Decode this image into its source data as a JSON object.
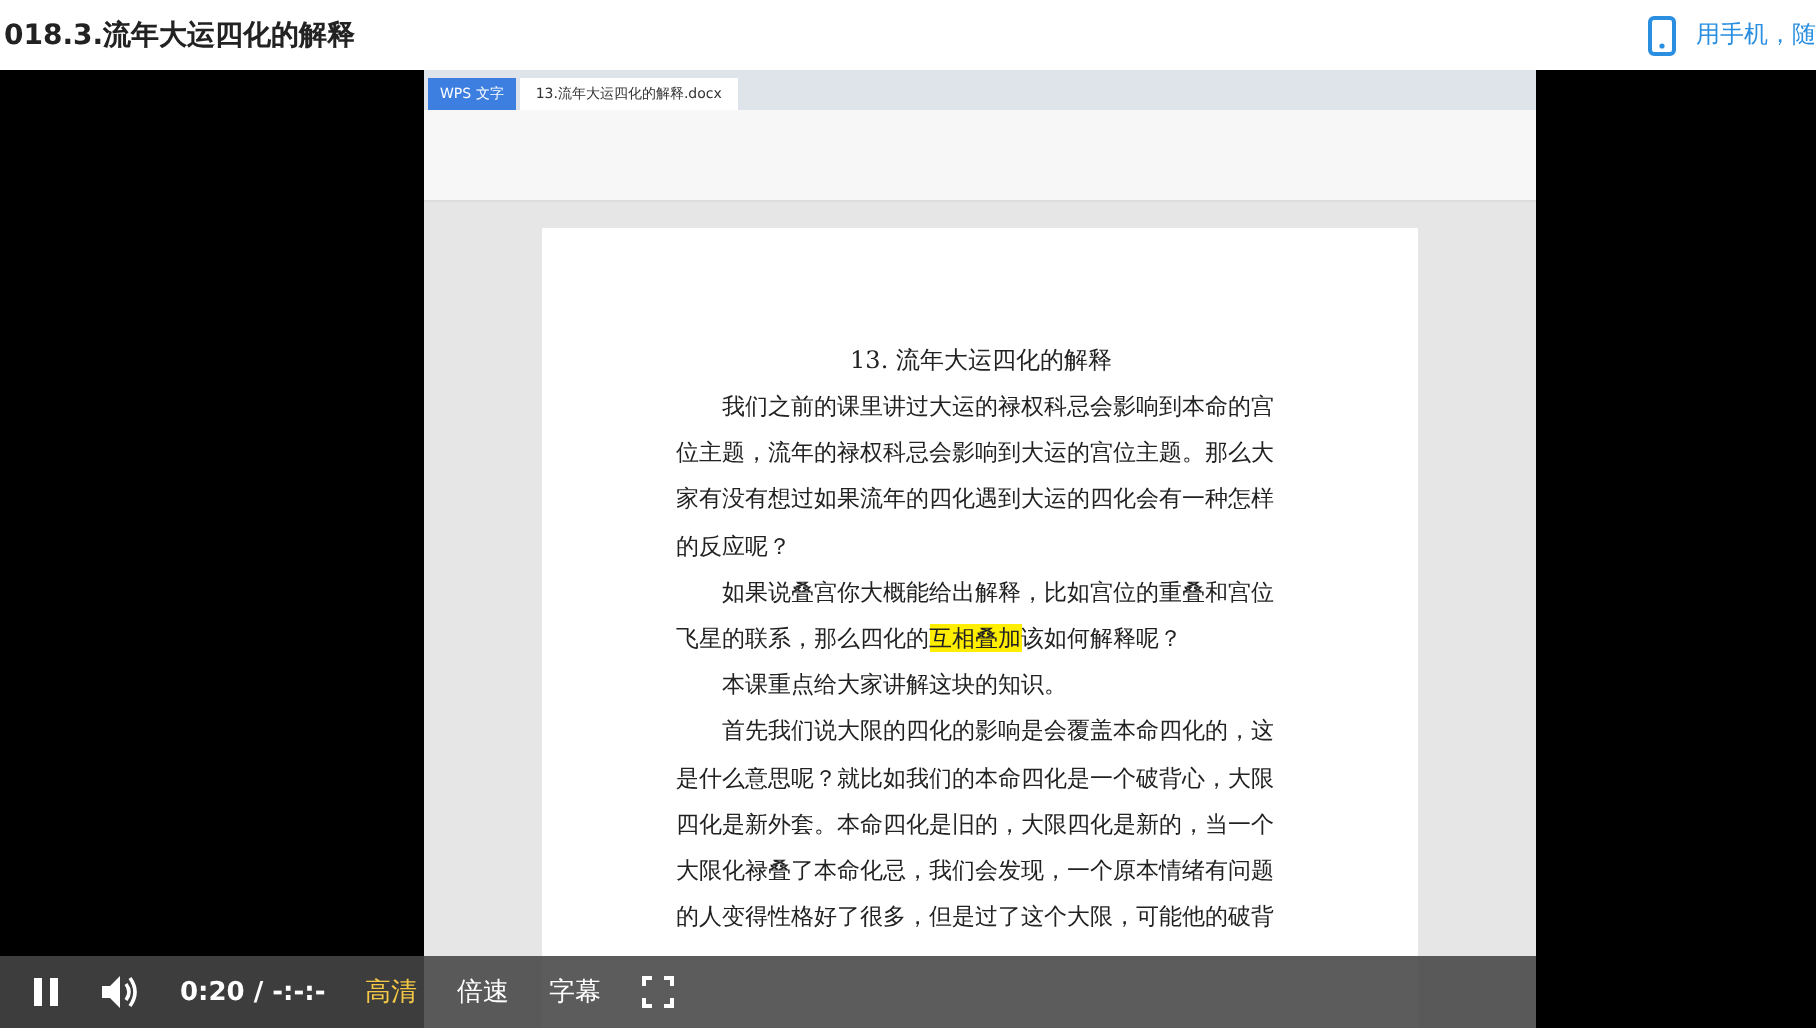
{
  "header": {
    "title": "018.3.流年大运四化的解释",
    "mobile_link": "用手机，随"
  },
  "document_window": {
    "app_tab": "WPS 文字",
    "file_tab": "13.流年大运四化的解释.docx",
    "page": {
      "heading": "13. 流年大运四化的解释",
      "paragraphs": [
        {
          "segments": [
            {
              "text": "我们之前的课里讲过大运的禄权科忌会影响到本命的宫位主题，流年的禄权科忌会影响到大运的宫位主题。那么大家有没有想过如果流年的四化遇到大运的四化会有一种怎样的反应呢？",
              "highlighted": false
            }
          ]
        },
        {
          "segments": [
            {
              "text": "如果说叠宫你大概能给出解释，比如宫位的重叠和宫位飞星的联系，那么四化的",
              "highlighted": false
            },
            {
              "text": "互相叠加",
              "highlighted": true
            },
            {
              "text": "该如何解释呢？",
              "highlighted": false
            }
          ]
        },
        {
          "segments": [
            {
              "text": "本课重点给大家讲解这块的知识。",
              "highlighted": false
            }
          ]
        },
        {
          "segments": [
            {
              "text": "首先我们说大限的四化的影响是会覆盖本命四化的，这是什么意思呢？就比如我们的本命四化是一个破背心，大限四化是新外套。本命四化是旧的，大限四化是新的，当一个大限化禄叠了本命化忌，我们会发现，一个原本情绪有问题的人变得性格好了很多，但是过了这个大限，可能他的破背",
              "highlighted": false
            }
          ]
        }
      ]
    }
  },
  "player": {
    "playing": true,
    "time": "0:20 / -:-:-",
    "options": [
      {
        "label": "高清",
        "selected": true
      },
      {
        "label": "倍速",
        "selected": false
      },
      {
        "label": "字幕",
        "selected": false
      }
    ]
  }
}
